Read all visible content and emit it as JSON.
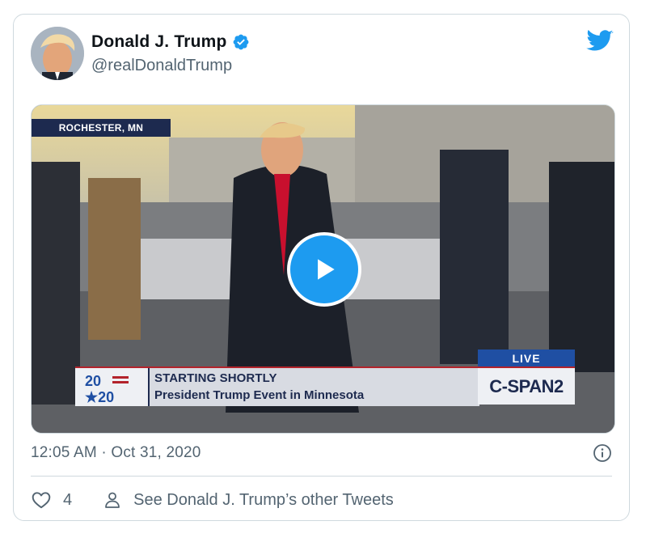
{
  "tweet": {
    "author": {
      "display_name": "Donald J. Trump",
      "handle": "@realDonaldTrump",
      "verified": true
    },
    "timestamp": "12:05 AM · Oct 31, 2020",
    "likes": "4",
    "other_tweets_link": "See Donald J. Trump’s other Tweets"
  },
  "video": {
    "location_tag": "ROCHESTER, MN",
    "chyron_title": "STARTING SHORTLY",
    "chyron_subtitle": "President Trump Event in Minnesota",
    "election_logo": "2020",
    "network_live": "LIVE",
    "network_name": "C-SPAN2"
  },
  "icons": {
    "brand": "twitter-bird-icon",
    "verified": "verified-badge-icon",
    "play": "play-icon",
    "info": "info-icon",
    "like": "heart-icon",
    "profile": "person-icon"
  },
  "colors": {
    "accent": "#1d9bf0",
    "text_secondary": "#536471",
    "border": "#cfd9de"
  }
}
